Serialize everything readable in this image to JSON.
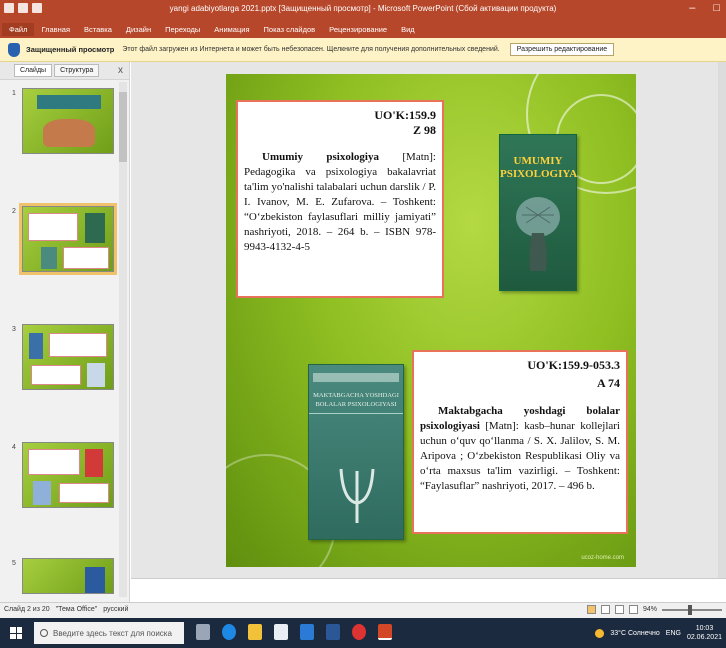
{
  "window": {
    "title": "yangi adabiyotlarga 2021.pptx [Защищенный просмотр] - Microsoft PowerPoint (Сбой активации продукта)",
    "controls": {
      "minimize": "–",
      "maximize": "□"
    }
  },
  "ribbon_tabs": [
    "Файл",
    "Главная",
    "Вставка",
    "Дизайн",
    "Переходы",
    "Анимация",
    "Показ слайдов",
    "Рецензирование",
    "Вид"
  ],
  "protected_view": {
    "title": "Защищенный просмотр",
    "message": "Этот файл загружен из Интернета и может быть небезопасен. Щелкните для получения дополнительных сведений.",
    "button": "Разрешить редактирование"
  },
  "side_panel": {
    "tabs": [
      "Слайды",
      "Структура"
    ],
    "close": "x",
    "slide_numbers": [
      "1",
      "2",
      "3",
      "4",
      "5"
    ]
  },
  "slide": {
    "card1": {
      "udk": "UO'K:159.9",
      "code": "Z 98",
      "title": "Umumiy psixologiya",
      "text": " [Matn]: Pedagogika va psixologiya bakalavriat ta'lim yo'nalishi talabalari uchun darslik / P. I. Ivanov, M. E. Zufarova. – Toshkent: “O‘zbekiston faylasuflari milliy jamiyati” nashriyoti, 2018. – 264 b. – ISBN 978-9943-4132-4-5"
    },
    "card2": {
      "udk": "UO'K:159.9-053.3",
      "code": "A 74",
      "title": "Maktabgacha yoshdagi bolalar psixologiyasi",
      "text": " [Matn]: kasb–hunar kollejlari uchun o‘quv qo‘llanma / S. X. Jalilov, S. M. Aripova ; O‘zbekiston Respublikasi Oliy va o‘rta maxsus ta'lim vazirligi. – Toshkent: “Faylasuflar” nashriyoti, 2017. – 496 b."
    },
    "book1_title": "UMUMIY PSIXOLOGIYA",
    "book2_title": "MAKTABGACHA YOSHDAGI BOLALAR PSIXOLOGIYASI",
    "watermark": "ucoz-home.com"
  },
  "status": {
    "slide_info": "Слайд 2 из 20",
    "theme": "\"Тема Office\"",
    "language": "русский",
    "zoom": "94%"
  },
  "taskbar": {
    "search_placeholder": "Введите здесь текст для поиска",
    "weather": "33°C Солнечно",
    "lang": "ENG",
    "time": "10:03",
    "date": "02.06.2021"
  }
}
